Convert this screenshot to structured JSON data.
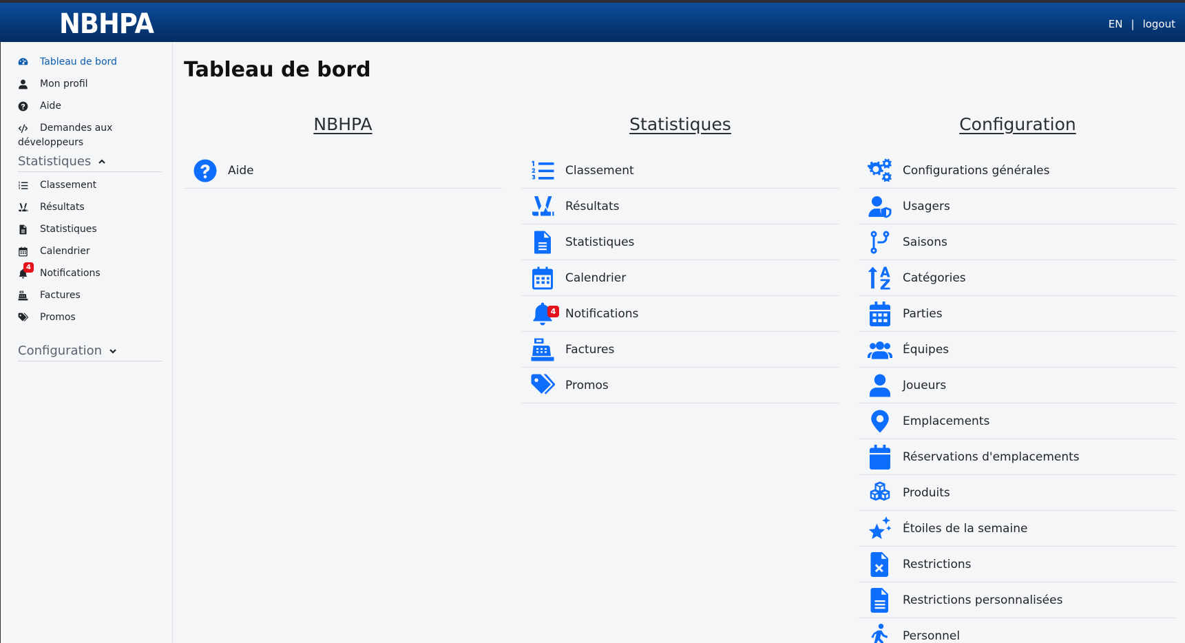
{
  "header": {
    "logo": "NBHPA",
    "lang": "EN",
    "separator": "|",
    "logout": "logout"
  },
  "sidebar": {
    "items": [
      {
        "label": "Tableau de bord",
        "icon": "dashboard-icon"
      },
      {
        "label": "Mon profil",
        "icon": "user-icon"
      },
      {
        "label": "Aide",
        "icon": "question-icon"
      },
      {
        "label": "Demandes aux développeurs",
        "icon": "code-icon"
      }
    ],
    "stats_section": "Statistiques",
    "stats_items": [
      {
        "label": "Classement",
        "icon": "list-ol-icon"
      },
      {
        "label": "Résultats",
        "icon": "hockey-icon"
      },
      {
        "label": "Statistiques",
        "icon": "file-icon"
      },
      {
        "label": "Calendrier",
        "icon": "calendar-icon"
      },
      {
        "label": "Notifications",
        "icon": "bell-icon",
        "badge": "4"
      },
      {
        "label": "Factures",
        "icon": "cash-register-icon"
      },
      {
        "label": "Promos",
        "icon": "tags-icon"
      }
    ],
    "config_section": "Configuration"
  },
  "main": {
    "title": "Tableau de bord",
    "columns": [
      {
        "heading": "NBHPA",
        "items": [
          {
            "label": "Aide",
            "icon": "question-icon"
          }
        ]
      },
      {
        "heading": "Statistiques",
        "items": [
          {
            "label": "Classement",
            "icon": "list-ol-icon"
          },
          {
            "label": "Résultats",
            "icon": "hockey-icon"
          },
          {
            "label": "Statistiques",
            "icon": "file-icon"
          },
          {
            "label": "Calendrier",
            "icon": "calendar-icon"
          },
          {
            "label": "Notifications",
            "icon": "bell-icon",
            "badge": "4"
          },
          {
            "label": "Factures",
            "icon": "cash-register-icon"
          },
          {
            "label": "Promos",
            "icon": "tags-icon"
          }
        ]
      },
      {
        "heading": "Configuration",
        "items": [
          {
            "label": "Configurations générales",
            "icon": "gears-icon"
          },
          {
            "label": "Usagers",
            "icon": "user-shield-icon"
          },
          {
            "label": "Saisons",
            "icon": "branch-icon"
          },
          {
            "label": "Catégories",
            "icon": "sort-az-icon"
          },
          {
            "label": "Parties",
            "icon": "calendar-days-icon"
          },
          {
            "label": "Équipes",
            "icon": "users-icon"
          },
          {
            "label": "Joueurs",
            "icon": "user-icon"
          },
          {
            "label": "Emplacements",
            "icon": "location-pin-icon"
          },
          {
            "label": "Réservations d'emplacements",
            "icon": "calendar-blank-icon"
          },
          {
            "label": "Produits",
            "icon": "cubes-icon"
          },
          {
            "label": "Étoiles de la semaine",
            "icon": "stars-icon"
          },
          {
            "label": "Restrictions",
            "icon": "file-x-icon"
          },
          {
            "label": "Restrictions personnalisées",
            "icon": "file-lines-icon"
          },
          {
            "label": "Personnel",
            "icon": "person-walking-icon"
          }
        ]
      }
    ]
  },
  "colors": {
    "accent": "#0d6efd",
    "header": "#063a7a",
    "badge": "#e3141b",
    "active": "#0b5cad"
  }
}
